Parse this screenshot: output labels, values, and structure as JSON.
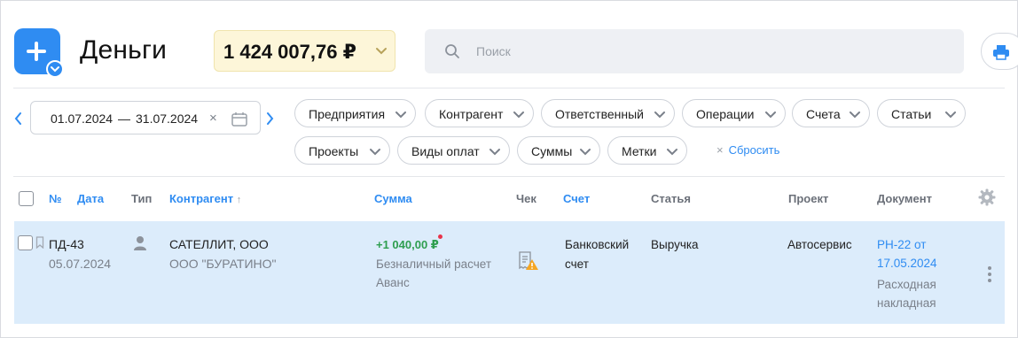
{
  "header": {
    "title": "Деньги",
    "balance": "1 424 007,76 ₽",
    "search_placeholder": "Поиск"
  },
  "filters": {
    "date_from": "01.07.2024",
    "date_sep": "—",
    "date_to": "31.07.2024",
    "clear_symbol": "×",
    "chips": [
      "Предприятия",
      "Контрагент",
      "Ответственный",
      "Операции",
      "Счета",
      "Статьи",
      "Проекты",
      "Виды оплат",
      "Суммы",
      "Метки"
    ],
    "reset_symbol": "×",
    "reset_label": "Сбросить"
  },
  "table": {
    "columns": {
      "no": "№",
      "date": "Дата",
      "type": "Тип",
      "counterparty": "Контрагент",
      "counterparty_sort": "↑",
      "amount": "Сумма",
      "receipt": "Чек",
      "account": "Счет",
      "article": "Статья",
      "project": "Проект",
      "document": "Документ"
    },
    "rows": [
      {
        "number": "ПД-43",
        "date": "05.07.2024",
        "counterparty": "САТЕЛЛИТ, ООО",
        "company": "ООО \"БУРАТИНО\"",
        "amount": "+1 040,00 ₽",
        "payment_type": "Безналичный расчет",
        "payment_kind": "Аванс",
        "account_line1": "Банковский",
        "account_line2": "счет",
        "article": "Выручка",
        "project": "Автосервис",
        "document_link_line1": "РН-22 от",
        "document_link_line2": "17.05.2024",
        "document_type_line1": "Расходная",
        "document_type_line2": "накладная"
      }
    ]
  },
  "colors": {
    "accent": "#2f8cf2",
    "balance_bg": "#fdf6d9",
    "row_selected": "#dcecfb",
    "positive": "#2e9e4f",
    "warning": "#f5a623",
    "alert_dot": "#e8334a"
  },
  "icons": [
    "plus-icon",
    "chevron-down-icon",
    "search-icon",
    "printer-icon",
    "chevron-left-icon",
    "chevron-right-icon",
    "calendar-icon",
    "gear-icon",
    "bookmark-icon",
    "person-icon",
    "receipt-warning-icon",
    "kebab-menu-icon"
  ]
}
